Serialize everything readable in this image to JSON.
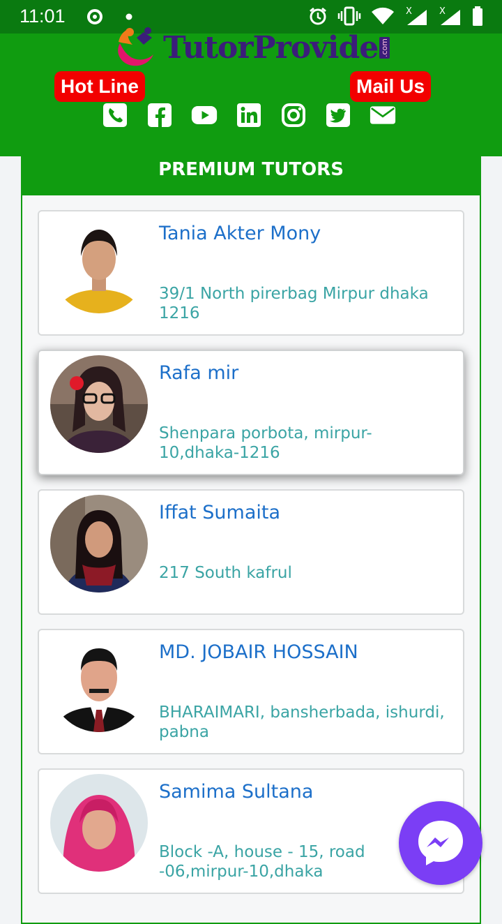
{
  "status": {
    "time": "11:01",
    "icons": [
      "sync-icon",
      "dot-icon",
      "alarm-icon",
      "vibrate-icon",
      "wifi-icon",
      "signal-x-icon",
      "signal-x-icon",
      "battery-icon"
    ]
  },
  "header": {
    "logo_text": "TutorProvide",
    "logo_suffix": ".com",
    "hotline_label": "Hot Line",
    "mail_label": "Mail Us",
    "socials": [
      "phone-icon",
      "facebook-icon",
      "youtube-icon",
      "linkedin-icon",
      "instagram-icon",
      "twitter-icon",
      "email-icon"
    ]
  },
  "section": {
    "title": "PREMIUM TUTORS"
  },
  "tutors": [
    {
      "name": "Tania Akter Mony",
      "address": "39/1 North pirerbag Mirpur dhaka 1216"
    },
    {
      "name": "Rafa mir",
      "address": "Shenpara porbota, mirpur-10,dhaka-1216"
    },
    {
      "name": "Iffat Sumaita",
      "address": "217 South kafrul"
    },
    {
      "name": "MD. JOBAIR HOSSAIN",
      "address": "BHARAIMARI, bansherbada, ishurdi, pabna"
    },
    {
      "name": "Samima Sultana",
      "address": "Block -A, house - 15, road -06,mirpur-10,dhaka"
    }
  ],
  "colors": {
    "brand_green": "#109c10",
    "status_green": "#0a7a10",
    "pill_red": "#f20000",
    "name_blue": "#1c6fc9",
    "address_teal": "#3aa4a4",
    "messenger_purple": "#7b3ef5"
  }
}
